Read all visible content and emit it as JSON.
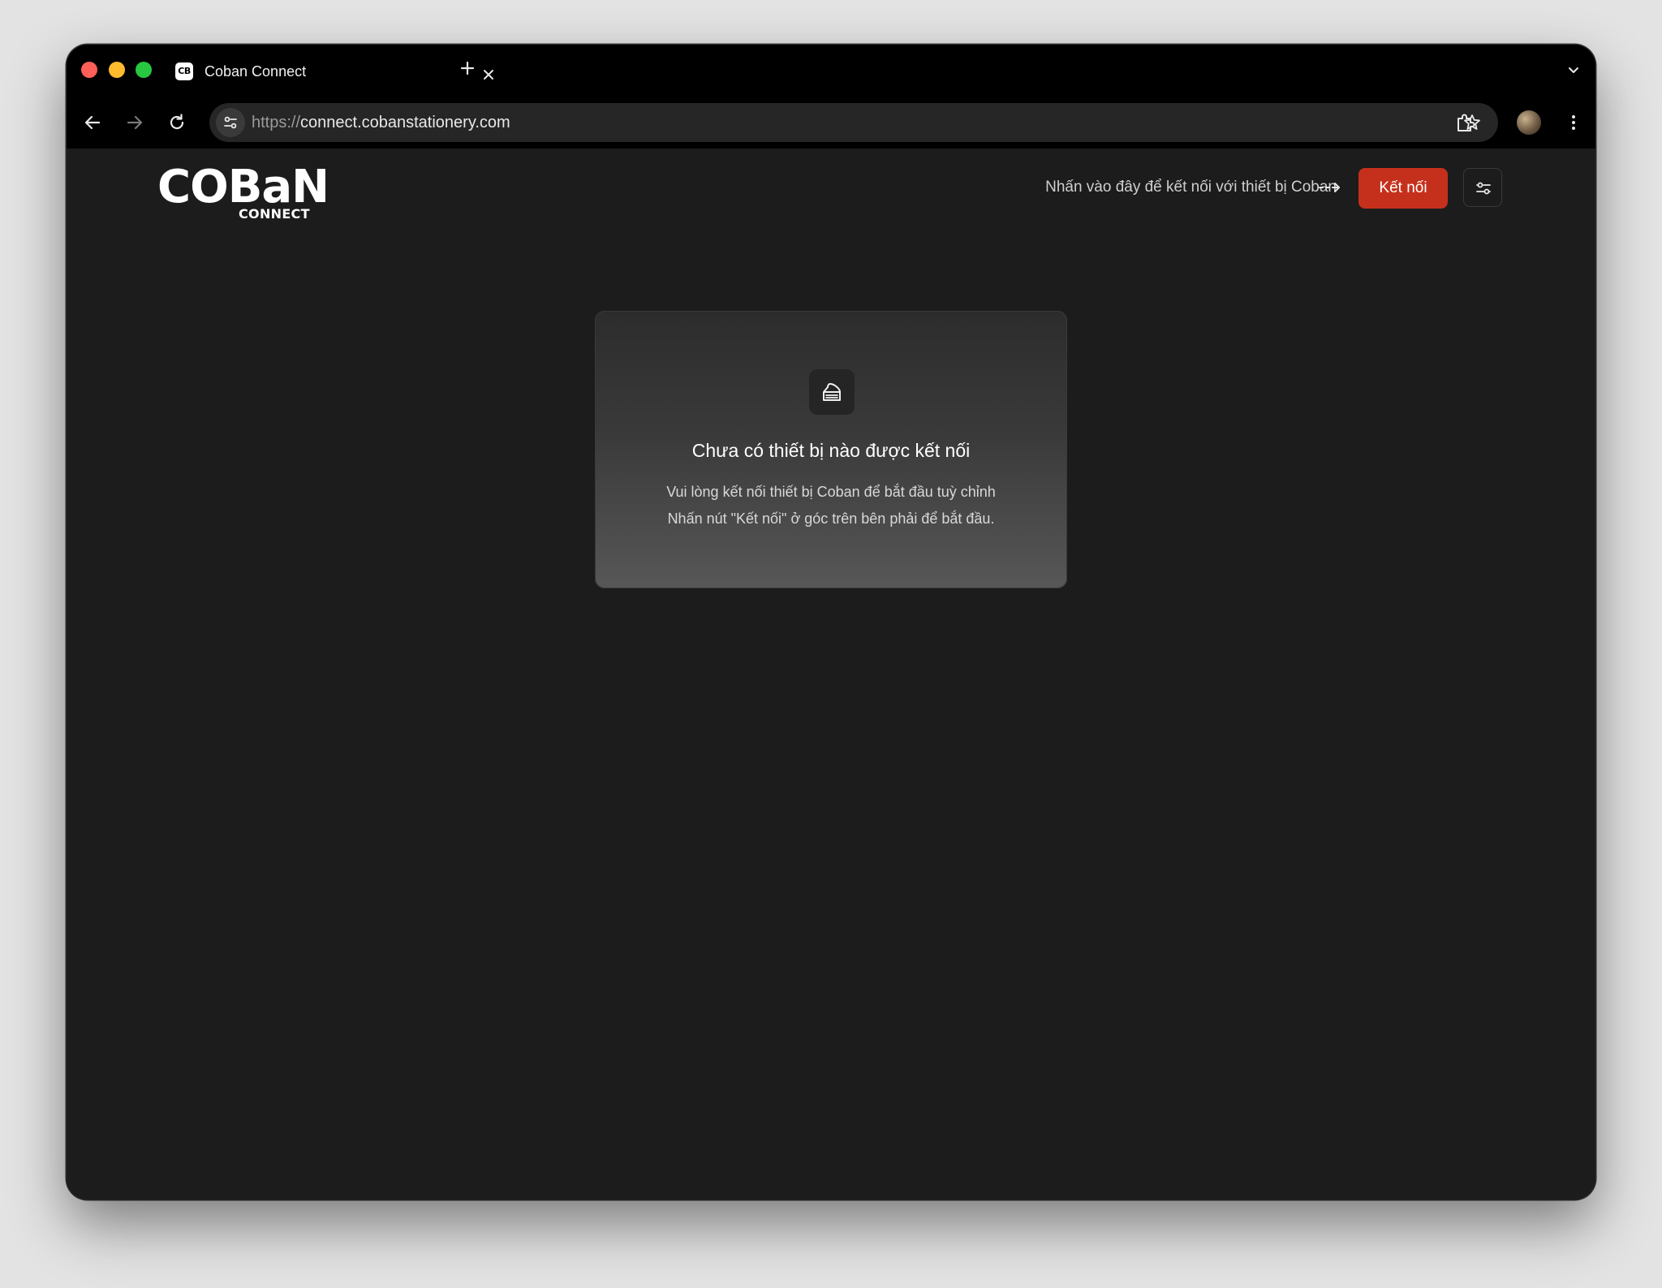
{
  "browser": {
    "tab": {
      "favicon_text": "CB",
      "title": "Coban Connect"
    },
    "url": {
      "scheme": "https://",
      "host": "connect.cobanstationery.com"
    },
    "icons": {
      "back": "arrow-left-icon",
      "forward": "arrow-right-icon",
      "reload": "reload-icon",
      "site_settings": "tune-icon",
      "bookmark": "star-icon",
      "extensions": "puzzle-icon",
      "menu": "kebab-icon",
      "tab_search": "chevron-down-icon"
    }
  },
  "header": {
    "logo_main": "COBaN",
    "logo_sub": "CONNECT",
    "hint": "Nhấn vào đây để kết nối với thiết bị Coban",
    "connect_label": "Kết nối",
    "accent_color": "#c5301c"
  },
  "empty_state": {
    "icon": "cake-icon",
    "title": "Chưa có thiết bị nào được kết nối",
    "line1": "Vui lòng kết nối thiết bị Coban để bắt đầu tuỳ chỉnh",
    "line2": "Nhấn nút \"Kết nối\" ở góc trên bên phải để bắt đầu."
  }
}
